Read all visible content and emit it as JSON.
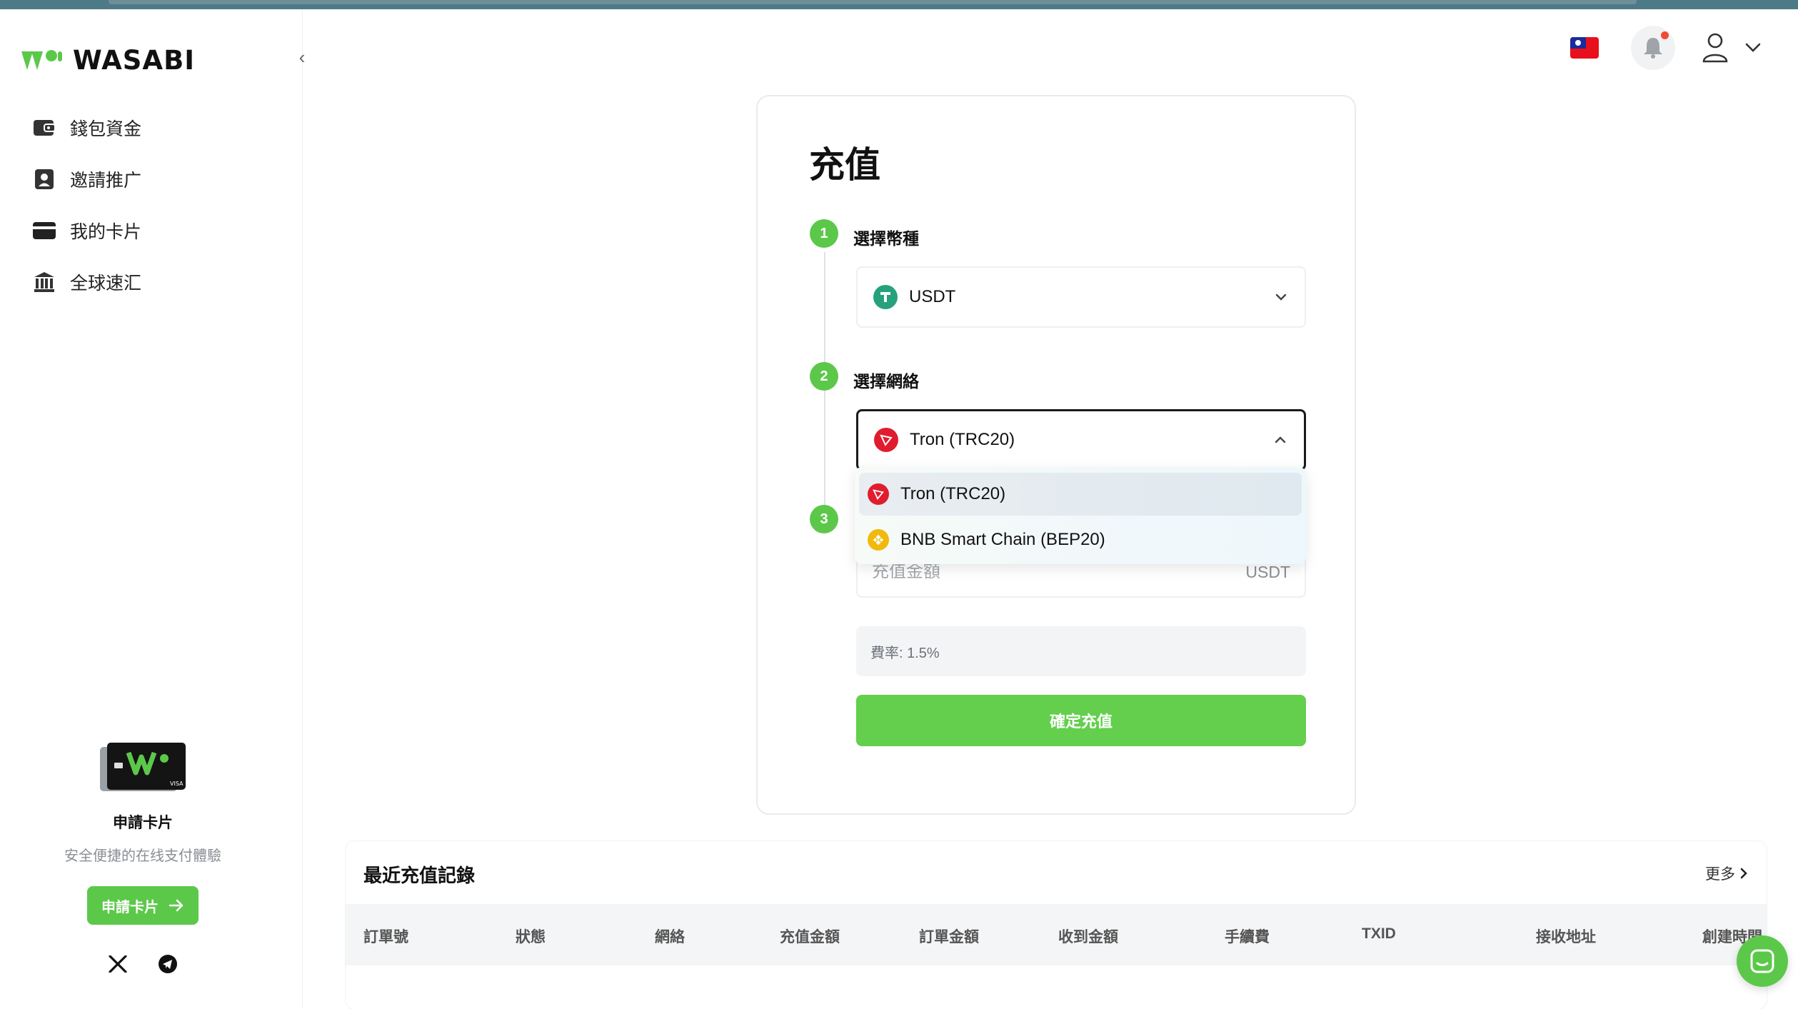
{
  "brand": {
    "name": "WASABI",
    "accent": "#5cc84a"
  },
  "sidebar": {
    "items": [
      {
        "label": "錢包資金",
        "icon": "wallet-icon"
      },
      {
        "label": "邀請推广",
        "icon": "user-card-icon"
      },
      {
        "label": "我的卡片",
        "icon": "credit-card-icon"
      },
      {
        "label": "全球速汇",
        "icon": "bank-icon"
      }
    ],
    "promo": {
      "title": "申請卡片",
      "subtitle": "安全便捷的在线支付體驗",
      "button": "申請卡片"
    }
  },
  "header": {
    "language_flag": "taiwan-flag-icon",
    "notification": "bell-icon",
    "has_unread": true
  },
  "deposit": {
    "title": "充值",
    "step1": {
      "num": "1",
      "label": "選擇幣種",
      "value": "USDT"
    },
    "step2": {
      "num": "2",
      "label": "選擇網絡",
      "value": "Tron (TRC20)"
    },
    "step3": {
      "num": "3"
    },
    "amount": {
      "placeholder": "充值金額",
      "unit": "USDT"
    },
    "fee": "費率: 1.5%",
    "confirm": "確定充值"
  },
  "network_dropdown": {
    "options": [
      {
        "label": "Tron (TRC20)",
        "selected": true
      },
      {
        "label": "BNB Smart Chain (BEP20)",
        "selected": false
      }
    ]
  },
  "records": {
    "title": "最近充值記錄",
    "more": "更多",
    "columns": [
      "訂單號",
      "狀態",
      "網絡",
      "充值金額",
      "訂單金額",
      "收到金額",
      "手續費",
      "TXID",
      "接收地址",
      "創建時間"
    ]
  }
}
